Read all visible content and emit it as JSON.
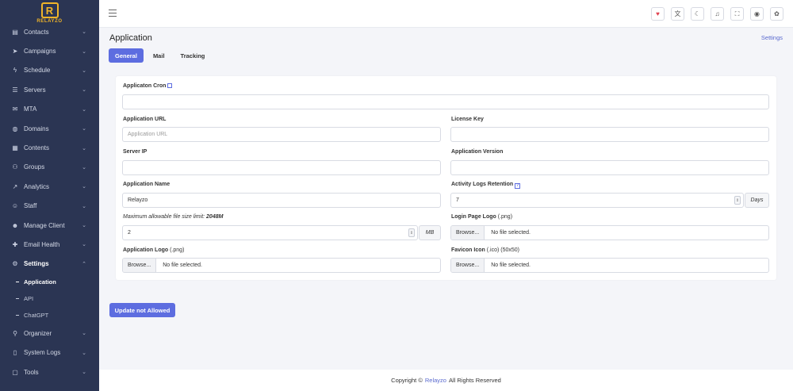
{
  "brand": {
    "logo_letter": "R",
    "name": "RELAYZO",
    "color": "#f0b429"
  },
  "sidebar": {
    "items": [
      {
        "label": "Contacts",
        "icon": "contacts-icon"
      },
      {
        "label": "Campaigns",
        "icon": "send-icon"
      },
      {
        "label": "Schedule",
        "icon": "bolt-icon"
      },
      {
        "label": "Servers",
        "icon": "database-icon"
      },
      {
        "label": "MTA",
        "icon": "mail-icon"
      },
      {
        "label": "Domains",
        "icon": "globe-icon"
      },
      {
        "label": "Contents",
        "icon": "contents-icon"
      },
      {
        "label": "Groups",
        "icon": "groups-icon"
      },
      {
        "label": "Analytics",
        "icon": "chart-icon"
      },
      {
        "label": "Staff",
        "icon": "staff-icon"
      },
      {
        "label": "Manage Client",
        "icon": "users-icon"
      },
      {
        "label": "Email Health",
        "icon": "health-icon"
      },
      {
        "label": "Settings",
        "icon": "gear-icon"
      }
    ],
    "settings_sub": [
      {
        "label": "Application"
      },
      {
        "label": "API"
      },
      {
        "label": "ChatGPT"
      }
    ],
    "after": [
      {
        "label": "Organizer",
        "icon": "pin-icon"
      },
      {
        "label": "System Logs",
        "icon": "book-icon"
      },
      {
        "label": "Tools",
        "icon": "tools-icon"
      }
    ]
  },
  "header": {
    "icons": [
      "heart-icon",
      "translate-icon",
      "moon-icon",
      "bell-icon",
      "fullscreen-icon",
      "user-icon",
      "palette-icon"
    ]
  },
  "page": {
    "title": "Application",
    "settings_link": "Settings",
    "tabs": [
      "General",
      "Mail",
      "Tracking"
    ]
  },
  "form": {
    "cron_label": "Applicaton Cron",
    "cron_value": "",
    "url_label": "Application URL",
    "url_placeholder": "Application URL",
    "license_label": "License Key",
    "license_value": "",
    "server_ip_label": "Server IP",
    "server_ip_value": "",
    "version_label": "Application Version",
    "version_value": "",
    "name_label": "Application Name",
    "name_value": "Relayzo",
    "retention_label": "Activity Logs Retention",
    "retention_value": "7",
    "retention_unit": "Days",
    "filesize_label_prefix": "Maximum allowable file size limit: ",
    "filesize_limit": "2048M",
    "filesize_value": "2",
    "filesize_unit": "MB",
    "login_logo_label": "Login Page Logo",
    "login_logo_hint": "(.png)",
    "app_logo_label": "Application Logo",
    "app_logo_hint": "(.png)",
    "favicon_label": "Favicon Icon",
    "favicon_hint": "(.ico) (50x50)",
    "browse_label": "Browse...",
    "no_file": "No file selected.",
    "submit_label": "Update not Allowed"
  },
  "footer": {
    "prefix": "Copyright ©",
    "brand": "Relayzo",
    "suffix": "All Rights Reserved"
  },
  "colors": {
    "accent": "#5d6de0",
    "sidebar_bg": "#2b3553"
  }
}
